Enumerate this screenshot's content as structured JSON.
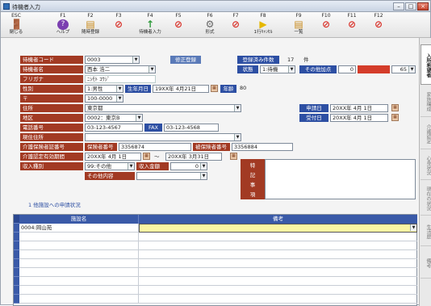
{
  "window": {
    "title": "待機者入力",
    "min": "–",
    "max": "□",
    "close": "×"
  },
  "toolbar": [
    {
      "key": "ESC",
      "label": "閉じる",
      "icon": "door-icon",
      "glyph": "🚪"
    },
    {
      "key": "F1",
      "label": "ヘルプ",
      "icon": "help-icon",
      "glyph": "?"
    },
    {
      "key": "F2",
      "label": "随時登録",
      "icon": "book-icon",
      "glyph": "▤"
    },
    {
      "key": "F3",
      "label": "",
      "icon": "prohibited-icon",
      "glyph": "⊘"
    },
    {
      "key": "F4",
      "label": "待機者入力",
      "icon": "up-arrow-icon",
      "glyph": "↑"
    },
    {
      "key": "F5",
      "label": "",
      "icon": "prohibited-icon",
      "glyph": "⊘"
    },
    {
      "key": "F6",
      "label": "形式",
      "icon": "gear-icon",
      "glyph": "⚙"
    },
    {
      "key": "F7",
      "label": "",
      "icon": "prohibited-icon",
      "glyph": "⊘"
    },
    {
      "key": "F8",
      "label": "1行ｷｬﾝｾﾙ",
      "icon": "arrow-right-icon",
      "glyph": "▶"
    },
    {
      "key": "F9",
      "label": "一覧",
      "icon": "list-icon",
      "glyph": "▤"
    },
    {
      "key": "F10",
      "label": "",
      "icon": "prohibited-icon",
      "glyph": "⊘"
    },
    {
      "key": "F11",
      "label": "",
      "icon": "prohibited-icon",
      "glyph": "⊘"
    },
    {
      "key": "F12",
      "label": "",
      "icon": "prohibited-icon",
      "glyph": "⊘"
    }
  ],
  "form": {
    "code_label": "待機者コード",
    "code_value": "0003",
    "correction_label": "修正登録",
    "registered_count_label": "登録済み件数",
    "registered_count": "17",
    "count_unit": "件",
    "name_label": "待機者名",
    "name_value": "西本 浩二",
    "status_label": "状態",
    "status_value": "1:待機",
    "other_points_label": "その他加点",
    "other_points_value": "0",
    "total_points_value": "65",
    "furigana_label": "フリガナ",
    "furigana_value": "ﾆｼﾓﾄ ｺｳｼﾞ",
    "gender_label": "性別",
    "gender_value": "1:男性",
    "birthdate_label": "生年月日",
    "birthdate_value": "19XX年 4月21日",
    "age_label": "年齢",
    "age_value": "80",
    "postal_label": "〒",
    "postal_value": "100-0000",
    "address_label": "住所",
    "address_value": "東京都",
    "application_date_label": "申請日",
    "application_date_value": "20XX年 4月 1日",
    "region_label": "地区",
    "region_value": "0002：東京B",
    "received_date_label": "受付日",
    "received_date_value": "20XX年 4月 1日",
    "phone_label": "電話番号",
    "phone_value": "03-123-4567",
    "fax_label": "FAX",
    "fax_value": "03-123-4568",
    "current_address_label": "現住住所",
    "current_address_value": "",
    "insurance_no_label": "介護保険者証番号",
    "insurer_no_label": "保険者番号",
    "insurer_no_value": "3356874",
    "insured_no_label": "被保険者番号",
    "insured_no_value": "3356884",
    "cert_period_label": "介護認定有効期間",
    "cert_from": "20XX年 4月 1日",
    "cert_sep": "～",
    "cert_to": "20XX年 3月31日",
    "income_type_label": "収入種別",
    "income_type_value": "99:その他",
    "income_amount_label": "収入金額",
    "income_amount_value": "0",
    "other_income_label": "その他内容",
    "other_income_value": "",
    "notes_label": "特記事項",
    "notes_chars": [
      "特",
      "記",
      "事",
      "項"
    ],
    "notes_value": ""
  },
  "facility_section": {
    "title": "1 他施設への申請状況"
  },
  "grid": {
    "headers": [
      "施設名",
      "備考"
    ],
    "rows": [
      {
        "facility": "0004:岡山苑",
        "remarks": ""
      }
    ]
  },
  "side_tabs": [
    "入所希望者",
    "家族構成",
    "介護認定",
    "心身状況",
    "現在の状況",
    "生活歴",
    "備考"
  ]
}
